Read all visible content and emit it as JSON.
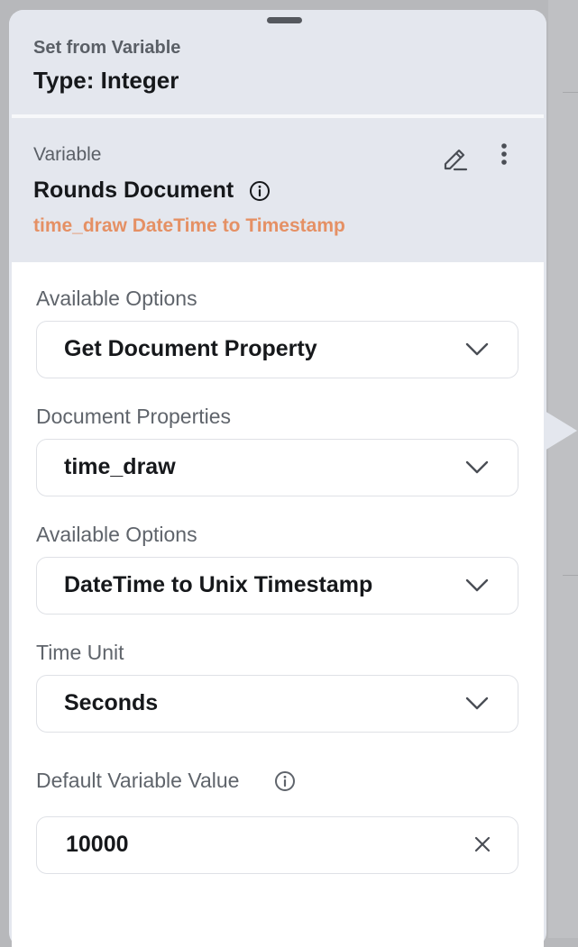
{
  "header": {
    "subtitle": "Set from Variable",
    "title": "Type: Integer"
  },
  "variable": {
    "label": "Variable",
    "name": "Rounds Document",
    "subtitle": "time_draw DateTime to Timestamp",
    "subtitle_color": "#e59064"
  },
  "fields": {
    "available_options_1": {
      "label": "Available Options",
      "value": "Get Document Property"
    },
    "document_properties": {
      "label": "Document Properties",
      "value": "time_draw"
    },
    "available_options_2": {
      "label": "Available Options",
      "value": "DateTime to Unix Timestamp"
    },
    "time_unit": {
      "label": "Time Unit",
      "value": "Seconds"
    },
    "default_value": {
      "label": "Default Variable Value",
      "value": "10000"
    }
  },
  "icons": [
    "info-icon",
    "edit-icon",
    "more-vertical-icon",
    "chevron-down-icon",
    "close-icon"
  ]
}
